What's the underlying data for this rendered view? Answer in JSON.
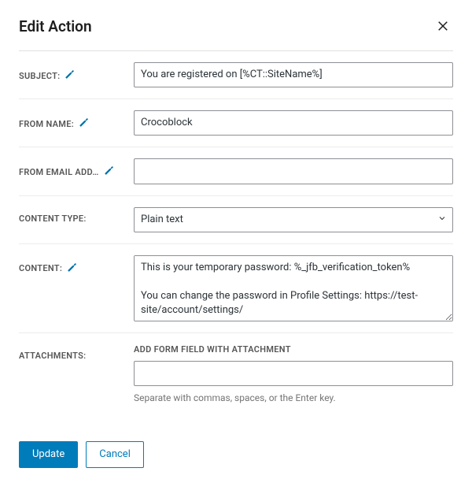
{
  "dialog": {
    "title": "Edit Action"
  },
  "fields": {
    "subject": {
      "label": "SUBJECT:",
      "value": "You are registered on [%CT::SiteName%]"
    },
    "from_name": {
      "label": "FROM NAME:",
      "value": "Crocoblock"
    },
    "from_email": {
      "label": "FROM EMAIL ADD…",
      "value": ""
    },
    "content_type": {
      "label": "CONTENT TYPE:",
      "value": "Plain text"
    },
    "content": {
      "label": "CONTENT:",
      "value": "This is your temporary password: %_jfb_verification_token%\n\nYou can change the password in Profile Settings: https://test-site/account/settings/"
    },
    "attachments": {
      "label": "ATTACHMENTS:",
      "sublabel": "ADD FORM FIELD WITH ATTACHMENT",
      "value": "",
      "help": "Separate with commas, spaces, or the Enter key."
    }
  },
  "buttons": {
    "update": "Update",
    "cancel": "Cancel"
  }
}
